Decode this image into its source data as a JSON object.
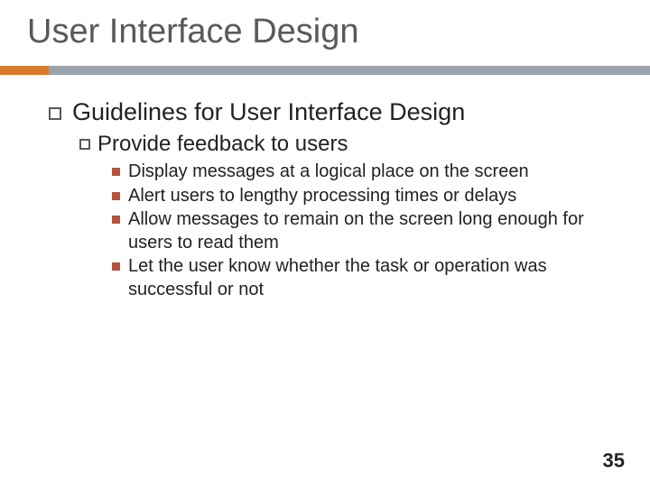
{
  "title": "User Interface Design",
  "content": {
    "level1": {
      "text": "Guidelines for User Interface Design"
    },
    "level2": {
      "text": "Provide feedback to users"
    },
    "level3": [
      "Display messages at a logical place on the screen",
      "Alert users to lengthy processing times or delays",
      "Allow messages to remain on the screen long enough for users to read them",
      "Let the user know whether the task or operation was successful or not"
    ]
  },
  "page_number": "35",
  "colors": {
    "accent_bar": "#9aa3ab",
    "accent_highlight": "#d97b2a",
    "bullet_square": "#b5533c",
    "title_color": "#595959"
  }
}
